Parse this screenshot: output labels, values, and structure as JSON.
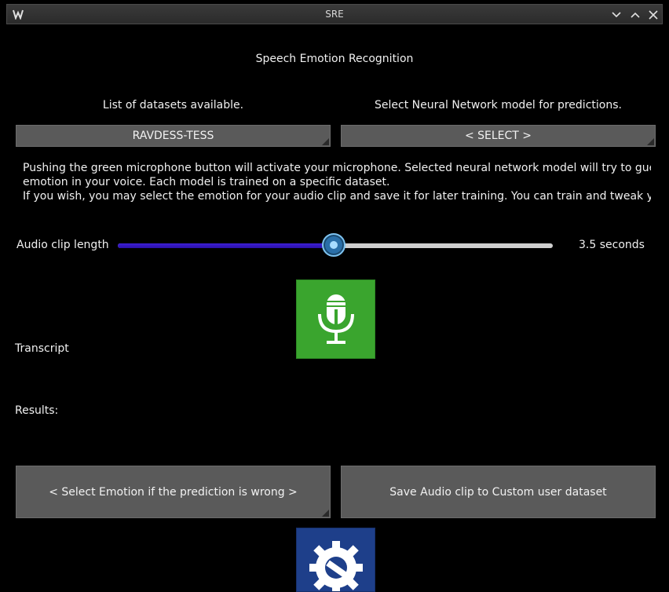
{
  "window": {
    "title": "SRE"
  },
  "header": {
    "heading": "Speech Emotion Recognition"
  },
  "datasets": {
    "label": "List of datasets available.",
    "selected": "RAVDESS-TESS"
  },
  "model": {
    "label": "Select Neural Network model for predictions.",
    "selected": "< SELECT >"
  },
  "info": {
    "line1": "Pushing the green microphone button will activate your microphone. Selected neural network model will try to guess",
    "line2": "emotion in your voice. Each model is trained on a specific dataset.",
    "line3": "If you wish, you may select the emotion for your audio clip and save it for later training. You can train and tweak your"
  },
  "clip": {
    "label": "Audio clip length",
    "value_text": "3.5 seconds",
    "slider_fraction": 0.497
  },
  "transcript": {
    "label": "Transcript"
  },
  "results": {
    "label": "Results:"
  },
  "actions": {
    "select_emotion": "< Select Emotion if the prediction is wrong >",
    "save_clip": "Save Audio clip to Custom user dataset"
  },
  "icons": {
    "mic": "microphone-icon",
    "settings": "settings-gear-wrench-icon",
    "app": "app-logo-icon"
  },
  "colors": {
    "mic_button": "#3aa52e",
    "settings_button": "#1e3f8a",
    "slider_fill": "#3d1fd6",
    "button": "#5a5a5a"
  }
}
